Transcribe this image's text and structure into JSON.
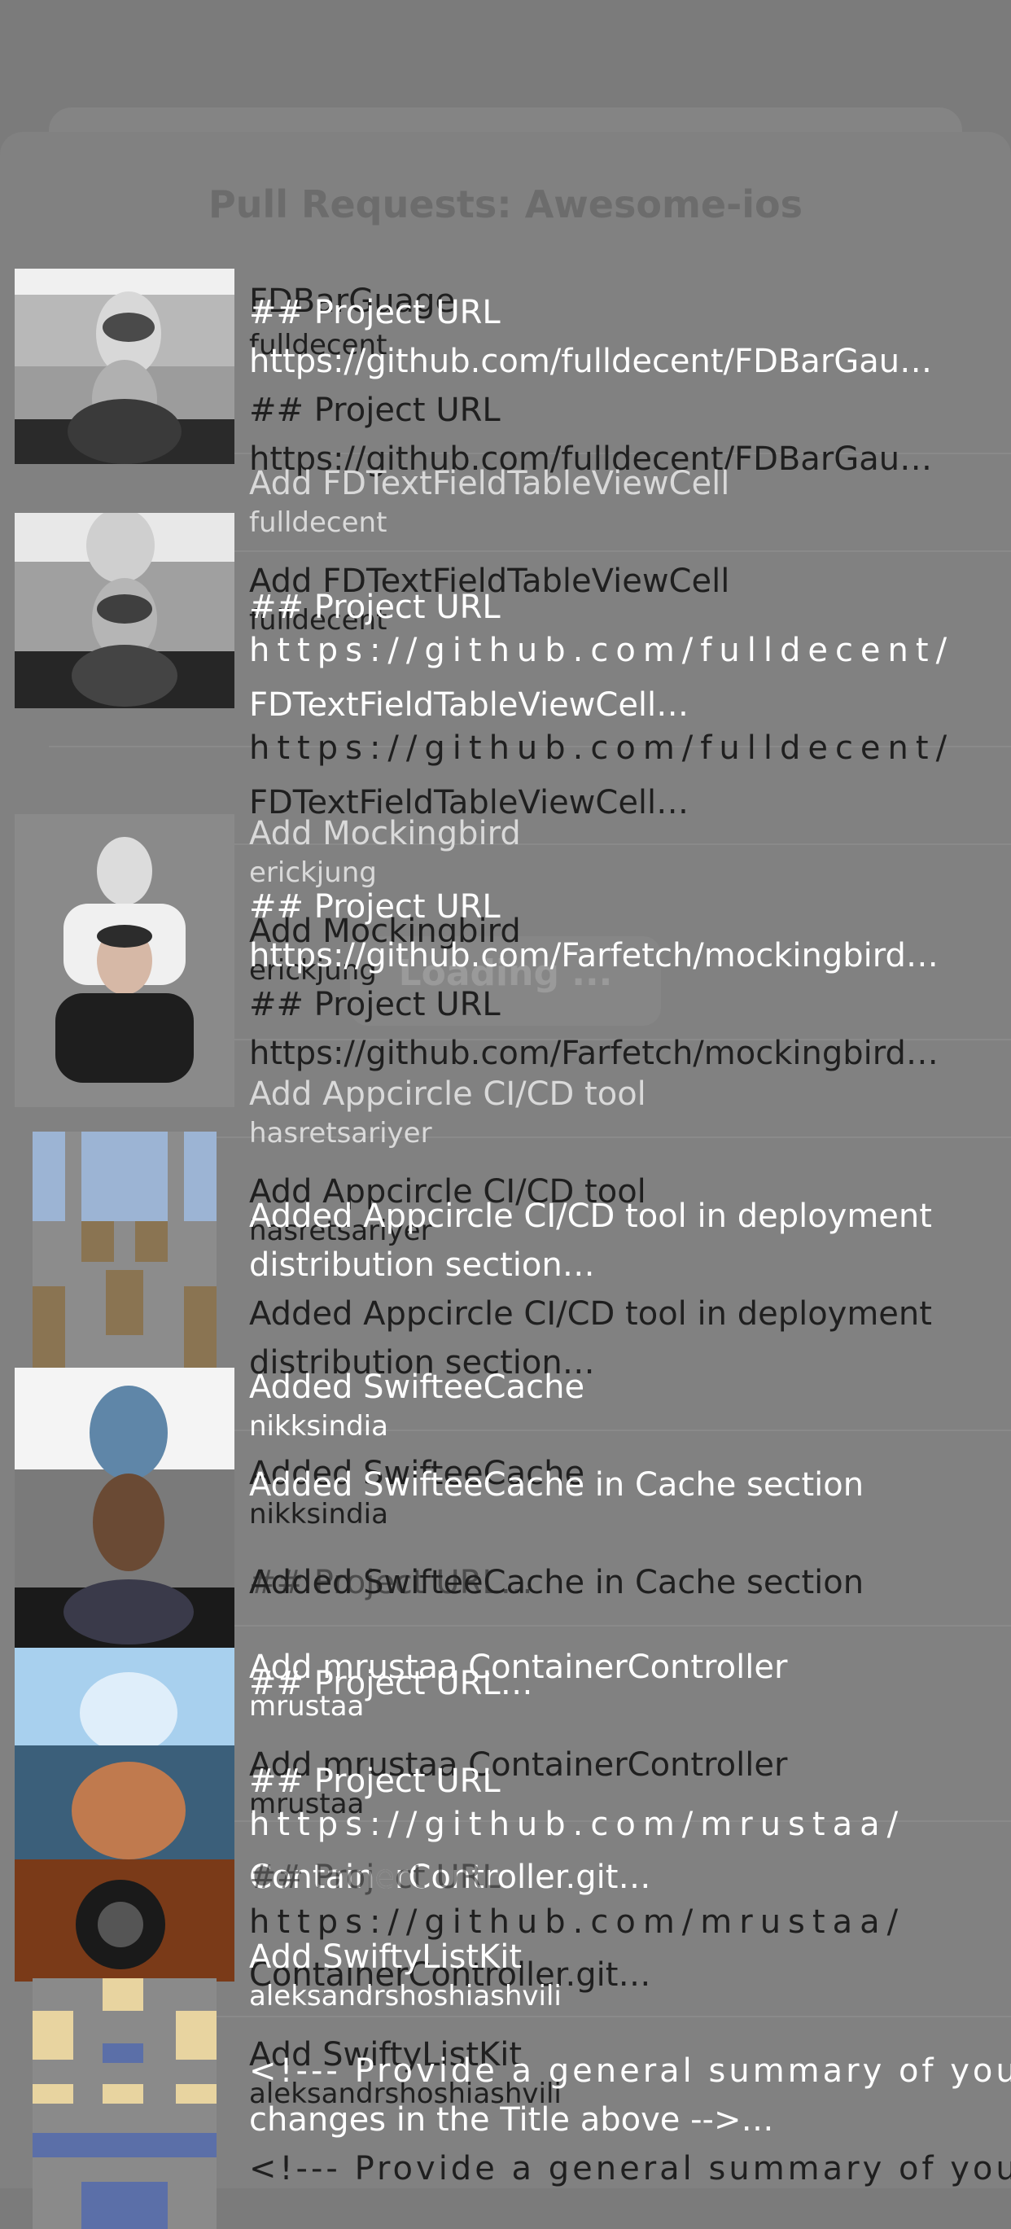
{
  "nav": {
    "title": "Pull Requests: Awesome-ios"
  },
  "status": {
    "loading": "Loading ..."
  },
  "colors": {
    "dim_background": "#7b7b7b",
    "sheet": "#818181",
    "text_light": "#ffffff",
    "text_dark": "#1f1f1f"
  },
  "pull_requests": [
    {
      "title": "FDBarGuage",
      "author": "fulldecent",
      "body_1": "## Project URL",
      "body_2": "https://github.com/fulldecent/FDBarGau…",
      "avatar": "avatar-photo-man"
    },
    {
      "title": "Add FDTextFieldTableViewCell",
      "author": "fulldecent",
      "body_1": "## Project URL",
      "body_2": "https://github.com/fulldecent/",
      "body_3": "FDTextFieldTableViewCell…",
      "avatar": "avatar-photo-man"
    },
    {
      "title": "Add Mockingbird",
      "author": "erickjung",
      "body_1": "## Project URL",
      "body_2": "https://github.com/Farfetch/mockingbird…",
      "avatar": "avatar-photo-man-black-shirt"
    },
    {
      "title": "Add Appcircle CI/CD tool",
      "author": "hasretsariyer",
      "body_1": "Added Appcircle CI/CD tool in deployment",
      "body_2": "distribution section…",
      "avatar": "avatar-identicon-blue-brown"
    },
    {
      "title": "Added SwifteeCache",
      "author": "nikksindia",
      "body_1": "Added SwifteeCache in Cache section",
      "body_2": "## Project URL…",
      "avatar": "avatar-photo-man"
    },
    {
      "title": "Add mrustaa ContainerController",
      "author": "mrustaa",
      "body_1": "## Project URL…",
      "body_2": "## Project URL",
      "body_3": "https://github.com/mrustaa/",
      "body_4": "ContainerController.git…",
      "avatar": "avatar-photo-camera"
    },
    {
      "title": "Add SwiftyListKit",
      "author": "aleksandrshoshiashvili",
      "body_1": "<!--- Provide a general summary of your",
      "body_2": "changes in the Title above -->…",
      "avatar": "avatar-identicon-yellow-blue"
    }
  ]
}
